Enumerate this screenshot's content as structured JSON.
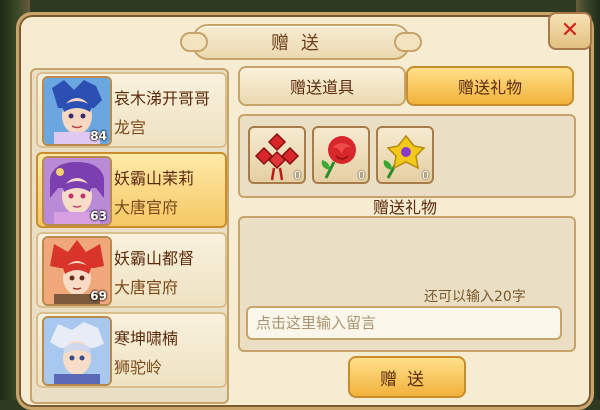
{
  "dialog": {
    "title": "赠送"
  },
  "close_button": {
    "icon": "close-icon",
    "color": "#d3231b"
  },
  "friends": [
    {
      "name": "哀木涕开哥哥",
      "faction": "龙宫",
      "level": "84",
      "selected": false
    },
    {
      "name": "妖霸山茉莉",
      "faction": "大唐官府",
      "level": "63",
      "selected": true
    },
    {
      "name": "妖霸山都督",
      "faction": "大唐官府",
      "level": "69",
      "selected": false
    },
    {
      "name": "寒坤啸楠",
      "faction": "狮驼岭",
      "level": "",
      "selected": false
    }
  ],
  "tabs": [
    {
      "label": "赠送道具",
      "active": false
    },
    {
      "label": "赠送礼物",
      "active": true
    }
  ],
  "gifts": [
    {
      "icon": "chinese-knot-icon",
      "count": "0"
    },
    {
      "icon": "rose-icon",
      "count": "0"
    },
    {
      "icon": "yellow-flower-icon",
      "count": "0"
    }
  ],
  "gift_section_label": "赠送礼物",
  "message": {
    "remaining_hint": "还可以输入20字",
    "placeholder": "点击这里输入留言",
    "value": ""
  },
  "send_button": {
    "label": "赠送"
  },
  "colors": {
    "accent": "#f2b23c",
    "panel": "#f6ecd2",
    "border": "#c7a46a"
  }
}
